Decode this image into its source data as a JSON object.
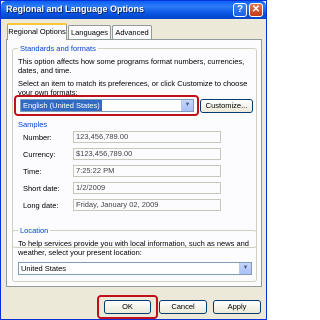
{
  "window": {
    "title": "Regional and Language Options",
    "help_glyph": "?",
    "close_glyph": "✕"
  },
  "tabs": [
    {
      "label": "Regional Options",
      "active": true
    },
    {
      "label": "Languages",
      "active": false
    },
    {
      "label": "Advanced",
      "active": false
    }
  ],
  "standards": {
    "group_title": "Standards and formats",
    "description_line1": "This option affects how some programs format numbers, currencies,",
    "description_line2": "dates, and time.",
    "instruction_line1": "Select an item to match its preferences, or click Customize to choose",
    "instruction_line2": "your own formats:",
    "selected_format": "English (United States)",
    "customize_label": "Customize..."
  },
  "samples": {
    "title": "Samples",
    "rows": [
      {
        "label": "Number:",
        "value": "123,456,789.00"
      },
      {
        "label": "Currency:",
        "value": "$123,456,789.00"
      },
      {
        "label": "Time:",
        "value": "7:25:22 PM"
      },
      {
        "label": "Short date:",
        "value": "1/2/2009"
      },
      {
        "label": "Long date:",
        "value": "Friday, January 02, 2009"
      }
    ]
  },
  "location": {
    "group_title": "Location",
    "description_line1": "To help services provide you with local information, such as news and",
    "description_line2": "weather, select your present location:",
    "selected_location": "United States"
  },
  "footer": {
    "ok_label": "OK",
    "cancel_label": "Cancel",
    "apply_label": "Apply"
  },
  "colors": {
    "title_bar": "#0a5ef5",
    "group_title": "#0046d5",
    "selection": "#316ac5",
    "highlight_border": "#c0101a"
  },
  "icons": {
    "combo_arrow": "▼"
  }
}
